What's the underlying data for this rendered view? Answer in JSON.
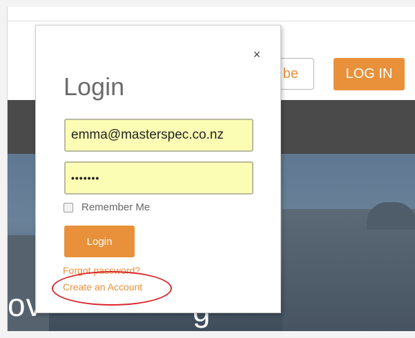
{
  "page": {
    "subscribe_label_partial": "be",
    "top_login_label": "LOG IN",
    "hero_text_left": "ov",
    "hero_text_right": "g"
  },
  "modal": {
    "close_glyph": "×",
    "title": "Login",
    "email_value": "emma@masterspec.co.nz",
    "password_value": "•••••••",
    "remember_label": "Remember Me",
    "remember_checked": false,
    "login_button_label": "Login",
    "forgot_password_label": "Forgot password?",
    "create_account_label": "Create an Account"
  },
  "annotation": {
    "highlight_color": "#d9252a",
    "highlight_target": "create-account-link"
  },
  "colors": {
    "accent": "#e8913a",
    "field_background": "#fbfdb4"
  }
}
